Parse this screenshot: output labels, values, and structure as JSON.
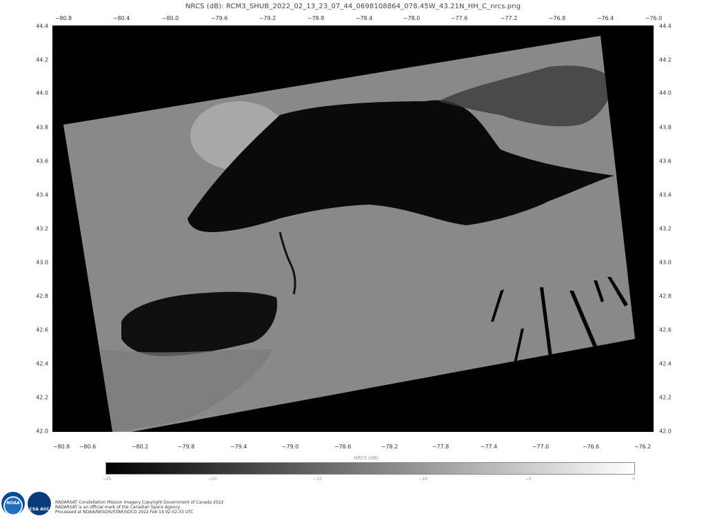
{
  "title": "NRCS (dB): RCM3_SHUB_2022_02_13_23_07_44_0698108864_078.45W_43.21N_HH_C_nrcs.png",
  "axes": {
    "top_ticks": [
      "−80.8",
      "−80.4",
      "−80.0",
      "−79.6",
      "−79.2",
      "−78.8",
      "−78.4",
      "−78.0",
      "−77.6",
      "−77.2",
      "−76.8",
      "−76.4",
      "−76.0"
    ],
    "bottom_ticks": [
      "−80.8",
      "−80.6",
      "−80.2",
      "−79.8",
      "−79.4",
      "−79.0",
      "−78.6",
      "−78.2",
      "−77.8",
      "−77.4",
      "−77.0",
      "−76.6",
      "−76.2"
    ],
    "left_ticks": [
      "44.4",
      "44.2",
      "44.0",
      "43.8",
      "43.6",
      "43.4",
      "43.2",
      "43.0",
      "42.8",
      "42.6",
      "42.4",
      "42.2",
      "42.0"
    ],
    "right_ticks": [
      "44.4",
      "44.2",
      "44.0",
      "43.8",
      "43.6",
      "43.4",
      "43.2",
      "43.0",
      "42.8",
      "42.6",
      "42.4",
      "42.2",
      "42.0"
    ]
  },
  "colorbar": {
    "label": "NRCS (dB)",
    "ticks": [
      "−25",
      "−20",
      "−15",
      "−10",
      "−5",
      "0"
    ],
    "colors": [
      "#000000",
      "#ffffff"
    ]
  },
  "logos": {
    "noaa_text": "NOAA",
    "csa_text": "CSA ASC"
  },
  "credits": [
    "RADARSAT Constellation Mission Imagery Copyright Government of Canada 2022",
    "RADARSAT is an official mark of the Canadian Space Agency",
    "Processed at NOAA/NESDIS/STAR/SOCD 2022 Feb 14 02:02:33 UTC"
  ],
  "colors": {
    "background": "#000000",
    "land": "#9a9a9a",
    "water": "#0a0a0a"
  }
}
